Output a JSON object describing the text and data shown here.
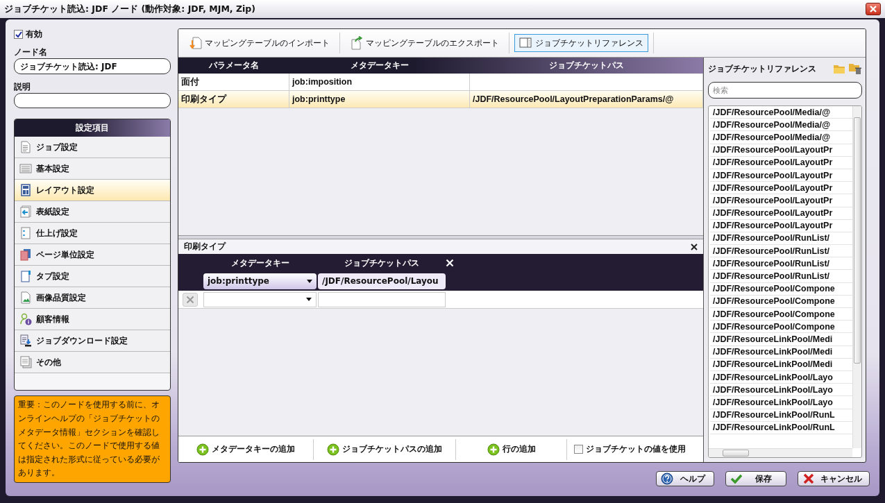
{
  "window": {
    "title": "ジョブチケット読込: JDF ノード (動作対象: JDF, MJM, Zip)"
  },
  "node": {
    "enabled_label": "有効",
    "enabled": true,
    "name_label": "ノード名",
    "name": "ジョブチケット読込: JDF",
    "description_label": "説明"
  },
  "settings": {
    "title": "設定項目",
    "items": [
      {
        "label": "ジョブ設定",
        "kind": "document",
        "selected": false
      },
      {
        "label": "基本設定",
        "kind": "list",
        "selected": false
      },
      {
        "label": "レイアウト設定",
        "kind": "layout",
        "selected": true
      },
      {
        "label": "表紙設定",
        "kind": "cover",
        "selected": false
      },
      {
        "label": "仕上げ設定",
        "kind": "finishing",
        "selected": false
      },
      {
        "label": "ページ単位設定",
        "kind": "pages",
        "selected": false
      },
      {
        "label": "タブ設定",
        "kind": "tab",
        "selected": false
      },
      {
        "label": "画像品質設定",
        "kind": "image",
        "selected": false
      },
      {
        "label": "顧客情報",
        "kind": "customer",
        "selected": false
      },
      {
        "label": "ジョブダウンロード設定",
        "kind": "download",
        "selected": false
      },
      {
        "label": "その他",
        "kind": "other",
        "selected": false
      }
    ]
  },
  "notice": "重要：このノードを使用する前に、オンラインヘルプの「ジョブチケットのメタデータ情報」セクションを確認してください。このノードで使用する値は指定された形式に従っている必要があります。",
  "toolbar": [
    {
      "label": "マッピングテーブルのインポート",
      "kind": "import",
      "selected": false
    },
    {
      "label": "マッピングテーブルのエクスポート",
      "kind": "export",
      "selected": false
    },
    {
      "label": "ジョブチケットリファレンス",
      "kind": "panel",
      "selected": true
    }
  ],
  "mapping_table": {
    "columns": [
      "パラメータ名",
      "メタデータキー",
      "ジョブチケットパス"
    ],
    "rows": [
      {
        "parameter": "面付",
        "metadata_key": "job:imposition",
        "selected": false
      },
      {
        "parameter": "印刷タイプ",
        "metadata_key": "job:printtype",
        "path": "/JDF/ResourcePool/LayoutPreparationParams/@",
        "selected": true
      }
    ]
  },
  "detail": {
    "title": "印刷タイプ",
    "columns": [
      "メタデータキー",
      "ジョブチケットパス"
    ],
    "entries": [
      {
        "metadata_key": "job:printtype",
        "path": "/JDF/ResourcePool/Layou"
      }
    ],
    "actions": [
      "メタデータキーの追加",
      "ジョブチケットパスの追加",
      "行の追加"
    ],
    "use_value": {
      "label": "ジョブチケットの値を使用",
      "checked": false
    }
  },
  "reference": {
    "title": "ジョブチケットリファレンス",
    "search_placeholder": "検索",
    "paths": [
      "/JDF/ResourcePool/Media/@",
      "/JDF/ResourcePool/Media/@",
      "/JDF/ResourcePool/Media/@",
      "/JDF/ResourcePool/LayoutPr",
      "/JDF/ResourcePool/LayoutPr",
      "/JDF/ResourcePool/LayoutPr",
      "/JDF/ResourcePool/LayoutPr",
      "/JDF/ResourcePool/LayoutPr",
      "/JDF/ResourcePool/LayoutPr",
      "/JDF/ResourcePool/LayoutPr",
      "/JDF/ResourcePool/RunList/",
      "/JDF/ResourcePool/RunList/",
      "/JDF/ResourcePool/RunList/",
      "/JDF/ResourcePool/RunList/",
      "/JDF/ResourcePool/Compone",
      "/JDF/ResourcePool/Compone",
      "/JDF/ResourcePool/Compone",
      "/JDF/ResourcePool/Compone",
      "/JDF/ResourceLinkPool/Medi",
      "/JDF/ResourceLinkPool/Medi",
      "/JDF/ResourceLinkPool/Medi",
      "/JDF/ResourceLinkPool/Layo",
      "/JDF/ResourceLinkPool/Layo",
      "/JDF/ResourceLinkPool/Layo",
      "/JDF/ResourceLinkPool/RunL",
      "/JDF/ResourceLinkPool/RunL"
    ]
  },
  "buttons": [
    {
      "label": "ヘルプ",
      "kind": "help"
    },
    {
      "label": "保存",
      "kind": "save"
    },
    {
      "label": "キャンセル",
      "kind": "cancel"
    }
  ]
}
